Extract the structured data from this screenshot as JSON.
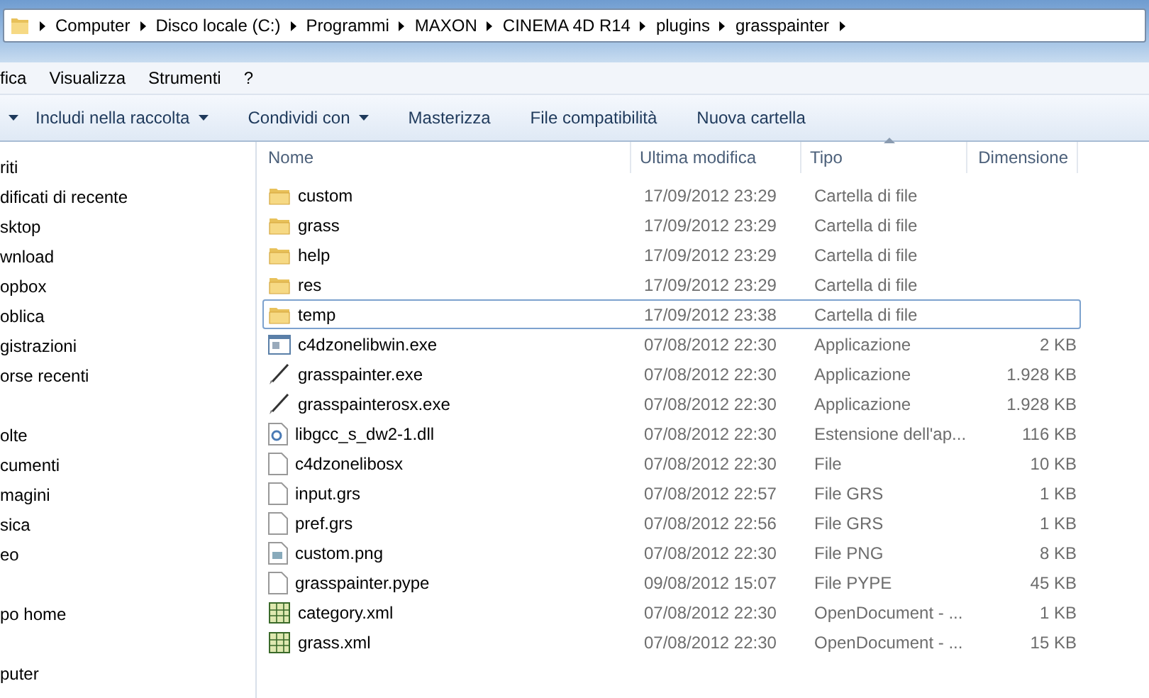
{
  "address_bar": {
    "segments": [
      "Computer",
      "Disco locale (C:)",
      "Programmi",
      "MAXON",
      "CINEMA 4D R14",
      "plugins",
      "grasspainter"
    ]
  },
  "menu_bar": [
    "fica",
    "Visualizza",
    "Strumenti",
    "?"
  ],
  "toolbar": [
    {
      "label": "Includi nella raccolta",
      "dropdown": true
    },
    {
      "label": "Condividi con",
      "dropdown": true
    },
    {
      "label": "Masterizza",
      "dropdown": false
    },
    {
      "label": "File compatibilità",
      "dropdown": false
    },
    {
      "label": "Nuova cartella",
      "dropdown": false
    }
  ],
  "sidebar": {
    "sections": [
      {
        "items": [
          "riti",
          "dificati di recente",
          "sktop",
          "wnload",
          "opbox",
          "oblica",
          "gistrazioni",
          "orse recenti"
        ]
      },
      {
        "items": [
          "olte",
          "cumenti",
          "magini",
          "sica",
          "eo"
        ]
      },
      {
        "items": [
          "po home"
        ]
      },
      {
        "items": [
          "puter"
        ]
      }
    ]
  },
  "table": {
    "columns": [
      {
        "label": "Nome",
        "sorted": false
      },
      {
        "label": "Ultima modifica",
        "sorted": false
      },
      {
        "label": "Tipo",
        "sorted": true
      },
      {
        "label": "Dimensione",
        "sorted": false
      }
    ],
    "rows": [
      {
        "kind": "folder",
        "name": "custom",
        "modified": "17/09/2012 23:29",
        "type": "Cartella di file",
        "size": "",
        "focused": false
      },
      {
        "kind": "folder",
        "name": "grass",
        "modified": "17/09/2012 23:29",
        "type": "Cartella di file",
        "size": "",
        "focused": false
      },
      {
        "kind": "folder",
        "name": "help",
        "modified": "17/09/2012 23:29",
        "type": "Cartella di file",
        "size": "",
        "focused": false
      },
      {
        "kind": "folder",
        "name": "res",
        "modified": "17/09/2012 23:29",
        "type": "Cartella di file",
        "size": "",
        "focused": false
      },
      {
        "kind": "folder",
        "name": "temp",
        "modified": "17/09/2012 23:38",
        "type": "Cartella di file",
        "size": "",
        "focused": true
      },
      {
        "kind": "app",
        "name": "c4dzonelibwin.exe",
        "modified": "07/08/2012 22:30",
        "type": "Applicazione",
        "size": "2 KB",
        "focused": false
      },
      {
        "kind": "brush",
        "name": "grasspainter.exe",
        "modified": "07/08/2012 22:30",
        "type": "Applicazione",
        "size": "1.928 KB",
        "focused": false
      },
      {
        "kind": "brush",
        "name": "grasspainterosx.exe",
        "modified": "07/08/2012 22:30",
        "type": "Applicazione",
        "size": "1.928 KB",
        "focused": false
      },
      {
        "kind": "dll",
        "name": "libgcc_s_dw2-1.dll",
        "modified": "07/08/2012 22:30",
        "type": "Estensione dell'ap...",
        "size": "116 KB",
        "focused": false
      },
      {
        "kind": "file",
        "name": "c4dzonelibosx",
        "modified": "07/08/2012 22:30",
        "type": "File",
        "size": "10 KB",
        "focused": false
      },
      {
        "kind": "file",
        "name": "input.grs",
        "modified": "07/08/2012 22:57",
        "type": "File GRS",
        "size": "1 KB",
        "focused": false
      },
      {
        "kind": "file",
        "name": "pref.grs",
        "modified": "07/08/2012 22:56",
        "type": "File GRS",
        "size": "1 KB",
        "focused": false
      },
      {
        "kind": "image",
        "name": "custom.png",
        "modified": "07/08/2012 22:30",
        "type": "File PNG",
        "size": "8 KB",
        "focused": false
      },
      {
        "kind": "file",
        "name": "grasspainter.pype",
        "modified": "09/08/2012 15:07",
        "type": "File PYPE",
        "size": "45 KB",
        "focused": false
      },
      {
        "kind": "sheet",
        "name": "category.xml",
        "modified": "07/08/2012 22:30",
        "type": "OpenDocument - ...",
        "size": "1 KB",
        "focused": false
      },
      {
        "kind": "sheet",
        "name": "grass.xml",
        "modified": "07/08/2012 22:30",
        "type": "OpenDocument - ...",
        "size": "15 KB",
        "focused": false
      }
    ]
  }
}
